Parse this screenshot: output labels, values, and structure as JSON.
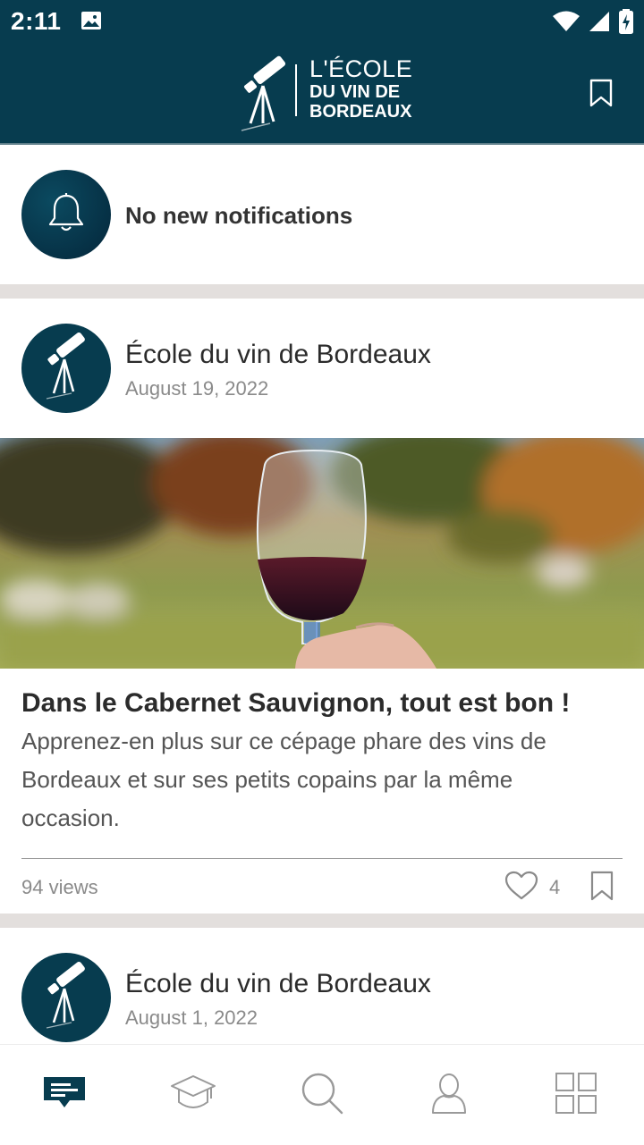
{
  "status_bar": {
    "time": "2:11",
    "left_icons": [
      "image-icon"
    ],
    "right_icons": [
      "wifi-icon",
      "cell-signal-icon",
      "battery-charging-icon"
    ]
  },
  "header": {
    "logo_line1": "L'ÉCOLE",
    "logo_line2": "DU VIN DE",
    "logo_line3": "BORDEAUX",
    "bookmark_icon": "bookmark-icon",
    "background": "#073c4f"
  },
  "notifications": {
    "icon": "bell-icon",
    "text": "No new notifications"
  },
  "posts": [
    {
      "author": "École du vin de Bordeaux",
      "date": "August 19, 2022",
      "title": "Dans le Cabernet Sauvignon, tout est bon !",
      "body": "Apprenez-en plus sur ce cépage phare des vins de Bordeaux et sur ses petits copains par la même occasion.",
      "views": "94 views",
      "likes": "4"
    },
    {
      "author": "École du vin de Bordeaux",
      "date": "August 1, 2022"
    }
  ],
  "bottom_nav": [
    {
      "name": "feed",
      "icon": "message-icon",
      "active": true
    },
    {
      "name": "courses",
      "icon": "graduation-cap-icon",
      "active": false
    },
    {
      "name": "search",
      "icon": "search-icon",
      "active": false
    },
    {
      "name": "profile",
      "icon": "user-icon",
      "active": false
    },
    {
      "name": "more",
      "icon": "grid-icon",
      "active": false
    }
  ],
  "colors": {
    "primary": "#073c4f",
    "separator": "#e3dfdd",
    "muted_text": "#8a8a8a",
    "inactive_icon": "#9a9a9a"
  }
}
